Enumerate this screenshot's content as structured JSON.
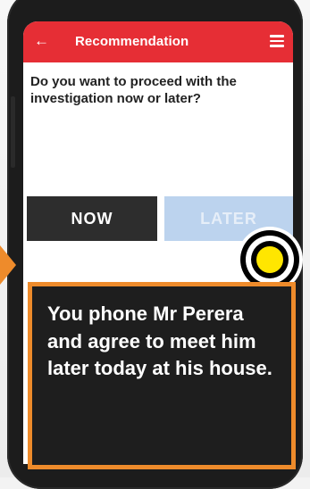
{
  "app_bar": {
    "back_icon": "arrow-left-icon",
    "title": "Recommendation",
    "menu_icon": "hamburger-menu-icon",
    "color": "#e62e35"
  },
  "question": {
    "text": "Do you want to proceed with the investigation now or later?"
  },
  "buttons": {
    "now_label": "NOW",
    "later_label": "LATER",
    "now_color": "#2d2d2d",
    "later_color": "#bcd3ee"
  },
  "callout": {
    "text": "You phone Mr Perera and agree to meet him later today at his house.",
    "border_color": "#ee8b2b",
    "background_color": "#1e1e1e"
  },
  "click_indicator": {
    "icon": "click-target-icon",
    "color": "#ffe600"
  }
}
